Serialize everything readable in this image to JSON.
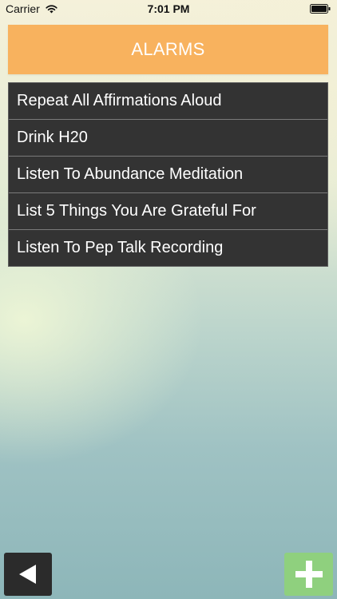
{
  "status_bar": {
    "carrier": "Carrier",
    "time": "7:01 PM",
    "wifi_icon": "wifi-icon",
    "battery_icon": "battery-icon"
  },
  "header": {
    "title": "ALARMS",
    "background_color": "#f8b25e"
  },
  "alarms": {
    "items": [
      {
        "label": "Repeat All Affirmations Aloud"
      },
      {
        "label": "Drink H20"
      },
      {
        "label": "Listen To Abundance Meditation"
      },
      {
        "label": "List 5 Things You Are Grateful For"
      },
      {
        "label": "Listen To Pep Talk Recording"
      }
    ],
    "row_color": "#333333"
  },
  "toolbar": {
    "back_icon": "left-triangle-icon",
    "back_color": "#2b2b2b",
    "add_icon": "plus-icon",
    "add_color": "#8fd07e"
  }
}
